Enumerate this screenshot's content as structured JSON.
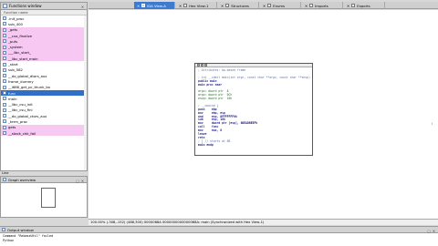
{
  "functions_window": {
    "title": "Functions window",
    "column_header": "Function name",
    "items": [
      {
        "name": ".init_proc",
        "style": "normal"
      },
      {
        "name": "sub_400",
        "style": "normal"
      },
      {
        "name": "_gets",
        "style": "pink"
      },
      {
        "name": "__cxa_finalize",
        "style": "pink"
      },
      {
        "name": "_puts",
        "style": "pink"
      },
      {
        "name": "_system",
        "style": "pink"
      },
      {
        "name": "___libc_start_",
        "style": "pink"
      },
      {
        "name": "__libc_start_main",
        "style": "pink"
      },
      {
        "name": "_start",
        "style": "normal"
      },
      {
        "name": "sub_582",
        "style": "normal"
      },
      {
        "name": "__do_global_dtors_aux",
        "style": "normal"
      },
      {
        "name": "frame_dummy",
        "style": "normal"
      },
      {
        "name": "__i686_get_pc_thunk_bx",
        "style": "normal"
      },
      {
        "name": "func",
        "style": "selected"
      },
      {
        "name": "main",
        "style": "normal"
      },
      {
        "name": "__libc_csu_init",
        "style": "normal"
      },
      {
        "name": "__libc_csu_fini",
        "style": "normal"
      },
      {
        "name": "__do_global_ctors_aux",
        "style": "normal"
      },
      {
        "name": "_term_proc",
        "style": "normal"
      },
      {
        "name": "gets",
        "style": "pink"
      },
      {
        "name": "__stack_chk_fail",
        "style": "pink"
      }
    ],
    "line_label": "Line"
  },
  "graph_overview": {
    "title": "Graph overview"
  },
  "tabs": [
    {
      "label": "IDA View-A",
      "active": true
    },
    {
      "label": "Hex View-1",
      "active": false
    },
    {
      "label": "Structures",
      "active": false
    },
    {
      "label": "Enums",
      "active": false
    },
    {
      "label": "Imports",
      "active": false
    },
    {
      "label": "Exports",
      "active": false
    }
  ],
  "graph_node": {
    "lines": [
      {
        "text": "; Attributes: bp-based frame",
        "cls": "c-cmt"
      },
      {
        "text": "",
        "cls": "c-blk"
      },
      {
        "text": "; int __cdecl main(int argc, const char **argv, const char **envp)",
        "cls": "c-cmt"
      },
      {
        "text": "public main",
        "cls": "c-kw"
      },
      {
        "text": "main proc near",
        "cls": "c-kw"
      },
      {
        "text": "",
        "cls": "c-blk"
      },
      {
        "text": "argc= dword ptr  8",
        "cls": "c-addr"
      },
      {
        "text": "argv= dword ptr  0Ch",
        "cls": "c-addr"
      },
      {
        "text": "envp= dword ptr  10h",
        "cls": "c-addr"
      },
      {
        "text": "",
        "cls": "c-blk"
      },
      {
        "text": "; __unwind {",
        "cls": "c-cmt"
      },
      {
        "text": "push    ebp",
        "cls": "c-kw"
      },
      {
        "text": "mov     ebp, esp",
        "cls": "c-kw"
      },
      {
        "text": "and     esp, 0FFFFFFF0h",
        "cls": "c-kw"
      },
      {
        "text": "sub     esp, 10h",
        "cls": "c-kw"
      },
      {
        "text": "mov     dword ptr [esp], 0DEADBEEFh",
        "cls": "c-kw"
      },
      {
        "text": "call    func",
        "cls": "c-kw"
      },
      {
        "text": "mov     eax, 0",
        "cls": "c-kw"
      },
      {
        "text": "leave",
        "cls": "c-kw"
      },
      {
        "text": "retn",
        "cls": "c-kw"
      },
      {
        "text": "; } // starts at 6B",
        "cls": "c-cmt"
      },
      {
        "text": "main endp",
        "cls": "c-kw"
      }
    ]
  },
  "status_line": "100.00% (-308,-152) (488,300) 0000068A 0000000000000068A: main (Synchronized with Hex View-1)",
  "output_window": {
    "title": "Output window",
    "lines": [
      "Command \"RebaseUtil\" failed",
      "Python"
    ]
  },
  "icons": {
    "pane_close": "✕",
    "pane_restore": "▢"
  }
}
